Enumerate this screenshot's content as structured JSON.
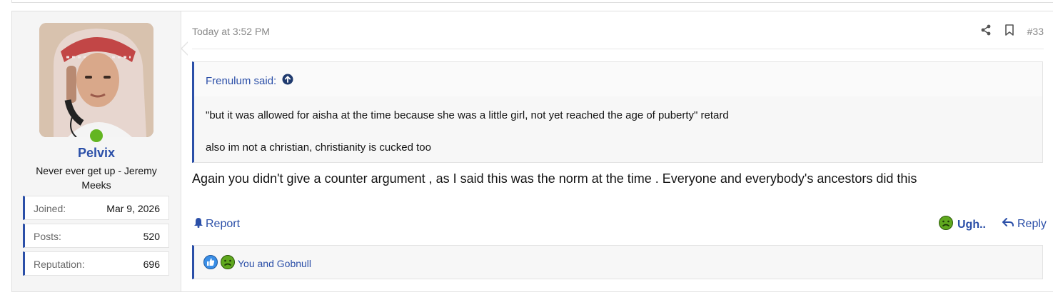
{
  "post": {
    "number": "#33",
    "date": "Today at 3:52 PM"
  },
  "user": {
    "name": "Pelvix",
    "title": "Never ever get up - Jeremy Meeks",
    "online": true,
    "extras": [
      {
        "label": "Joined:",
        "value": "Mar 9, 2026"
      },
      {
        "label": "Posts:",
        "value": "520"
      },
      {
        "label": "Reputation:",
        "value": "696"
      }
    ]
  },
  "quote": {
    "author": "Frenulum said:",
    "lines": [
      "\"but it was allowed for aisha at the time because she was a little girl, not yet reached the age of puberty\" retard",
      "also im not a christian, christianity is cucked too"
    ]
  },
  "body": "Again you didn't give a counter argument , as I said this was the norm at the time . Everyone and everybody's ancestors did this",
  "actions": {
    "report": "Report",
    "reaction": "Ugh..",
    "reply": "Reply"
  },
  "reactions_summary": {
    "text": "You and Gobnull",
    "icons": [
      "like-icon",
      "ugh-icon"
    ]
  },
  "colors": {
    "accent": "#2b4fa8",
    "online": "#63b521",
    "ugh_face": "#5fa81e",
    "like_blue": "#3a8ee6"
  }
}
